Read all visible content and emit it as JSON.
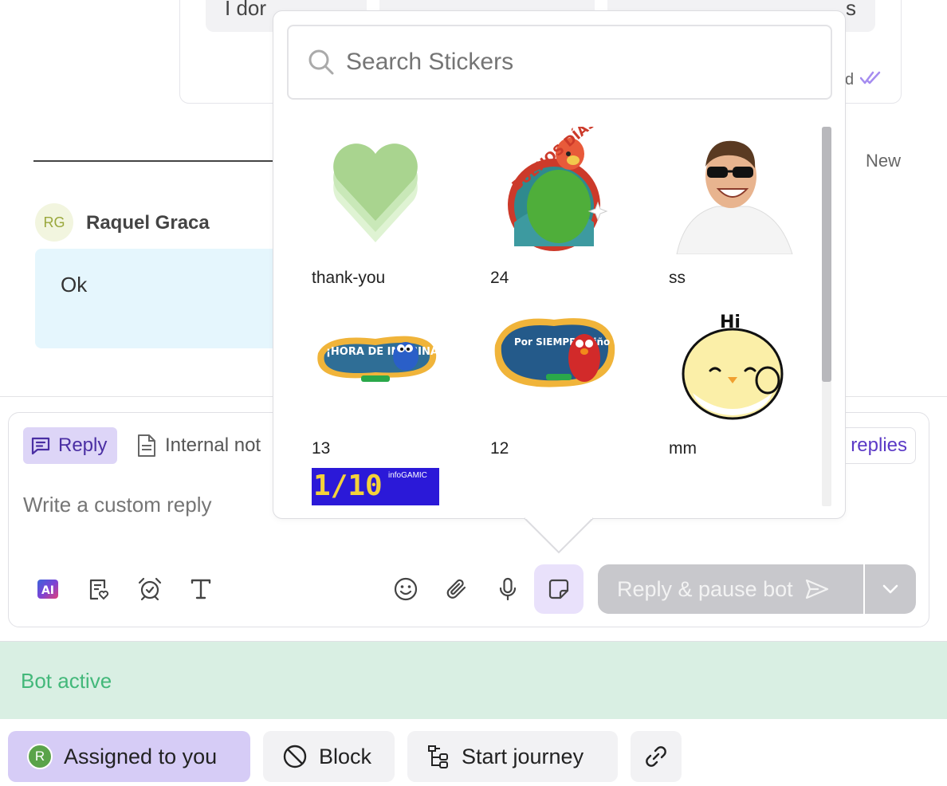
{
  "chat": {
    "quick_replies": [
      "I dor",
      "s"
    ],
    "read_status": "d",
    "new_label": "New",
    "sender_initials": "RG",
    "sender_name": "Raquel Graca",
    "message_text": "Ok"
  },
  "composer": {
    "tab_reply": "Reply",
    "tab_internal_note": "Internal not",
    "saved_replies": "replies",
    "input_placeholder": "Write a custom reply",
    "send_label": "Reply & pause bot",
    "tools_left": [
      "ai-icon",
      "signature-icon",
      "alarm-icon",
      "text-format-icon"
    ],
    "tools_right": [
      "emoji-icon",
      "attachment-icon",
      "microphone-icon",
      "sticker-icon"
    ],
    "ai_label": "AI"
  },
  "sticker_picker": {
    "search_placeholder": "Search Stickers",
    "stickers": [
      {
        "label": "thank-you",
        "icon": "heart-sticker"
      },
      {
        "label": "24",
        "icon": "buenos-dias-sticker",
        "art_text": "BUENOS DÍAS"
      },
      {
        "label": "ss",
        "icon": "sunglasses-man-sticker"
      },
      {
        "label": "13",
        "icon": "hora-de-imaginar-sticker",
        "art_text": "¡HORA DE IMAGINAR!"
      },
      {
        "label": "12",
        "icon": "por-siempre-nino-sticker",
        "art_text": "Por SIEMPRE niño"
      },
      {
        "label": "mm",
        "icon": "hi-chick-sticker",
        "art_text": "Hi"
      },
      {
        "label": "",
        "icon": "infogamic-sticker",
        "art_text": "1/10",
        "brand_text": "infoGAMIC"
      }
    ]
  },
  "bot_banner": {
    "text": "Bot active"
  },
  "footer": {
    "assigned_avatar": "R",
    "assigned_label": "Assigned to you",
    "block_label": "Block",
    "journey_label": "Start journey"
  },
  "colors": {
    "accent_purple": "#5b39c6",
    "reply_tab_bg": "#ddd5f7",
    "bot_banner_bg": "#d9efe3",
    "bot_text": "#43b87a",
    "send_button_bg": "#c8c8cc"
  }
}
